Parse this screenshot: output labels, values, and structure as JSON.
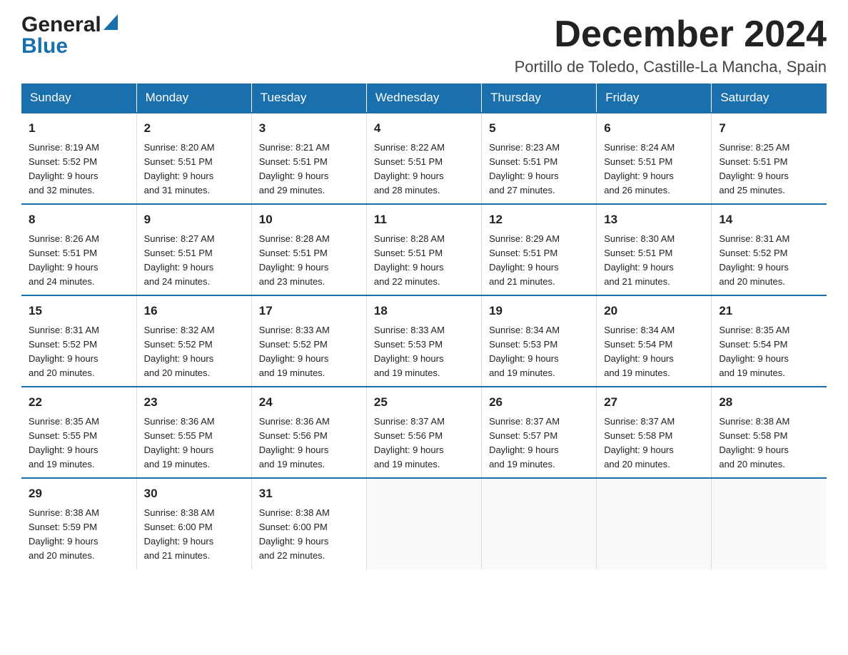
{
  "logo": {
    "general": "General",
    "blue": "Blue",
    "triangle_color": "#1a6fad"
  },
  "header": {
    "month_title": "December 2024",
    "location": "Portillo de Toledo, Castille-La Mancha, Spain"
  },
  "weekdays": [
    "Sunday",
    "Monday",
    "Tuesday",
    "Wednesday",
    "Thursday",
    "Friday",
    "Saturday"
  ],
  "weeks": [
    [
      {
        "day": "1",
        "sunrise": "8:19 AM",
        "sunset": "5:52 PM",
        "daylight": "9 hours and 32 minutes."
      },
      {
        "day": "2",
        "sunrise": "8:20 AM",
        "sunset": "5:51 PM",
        "daylight": "9 hours and 31 minutes."
      },
      {
        "day": "3",
        "sunrise": "8:21 AM",
        "sunset": "5:51 PM",
        "daylight": "9 hours and 29 minutes."
      },
      {
        "day": "4",
        "sunrise": "8:22 AM",
        "sunset": "5:51 PM",
        "daylight": "9 hours and 28 minutes."
      },
      {
        "day": "5",
        "sunrise": "8:23 AM",
        "sunset": "5:51 PM",
        "daylight": "9 hours and 27 minutes."
      },
      {
        "day": "6",
        "sunrise": "8:24 AM",
        "sunset": "5:51 PM",
        "daylight": "9 hours and 26 minutes."
      },
      {
        "day": "7",
        "sunrise": "8:25 AM",
        "sunset": "5:51 PM",
        "daylight": "9 hours and 25 minutes."
      }
    ],
    [
      {
        "day": "8",
        "sunrise": "8:26 AM",
        "sunset": "5:51 PM",
        "daylight": "9 hours and 24 minutes."
      },
      {
        "day": "9",
        "sunrise": "8:27 AM",
        "sunset": "5:51 PM",
        "daylight": "9 hours and 24 minutes."
      },
      {
        "day": "10",
        "sunrise": "8:28 AM",
        "sunset": "5:51 PM",
        "daylight": "9 hours and 23 minutes."
      },
      {
        "day": "11",
        "sunrise": "8:28 AM",
        "sunset": "5:51 PM",
        "daylight": "9 hours and 22 minutes."
      },
      {
        "day": "12",
        "sunrise": "8:29 AM",
        "sunset": "5:51 PM",
        "daylight": "9 hours and 21 minutes."
      },
      {
        "day": "13",
        "sunrise": "8:30 AM",
        "sunset": "5:51 PM",
        "daylight": "9 hours and 21 minutes."
      },
      {
        "day": "14",
        "sunrise": "8:31 AM",
        "sunset": "5:52 PM",
        "daylight": "9 hours and 20 minutes."
      }
    ],
    [
      {
        "day": "15",
        "sunrise": "8:31 AM",
        "sunset": "5:52 PM",
        "daylight": "9 hours and 20 minutes."
      },
      {
        "day": "16",
        "sunrise": "8:32 AM",
        "sunset": "5:52 PM",
        "daylight": "9 hours and 20 minutes."
      },
      {
        "day": "17",
        "sunrise": "8:33 AM",
        "sunset": "5:52 PM",
        "daylight": "9 hours and 19 minutes."
      },
      {
        "day": "18",
        "sunrise": "8:33 AM",
        "sunset": "5:53 PM",
        "daylight": "9 hours and 19 minutes."
      },
      {
        "day": "19",
        "sunrise": "8:34 AM",
        "sunset": "5:53 PM",
        "daylight": "9 hours and 19 minutes."
      },
      {
        "day": "20",
        "sunrise": "8:34 AM",
        "sunset": "5:54 PM",
        "daylight": "9 hours and 19 minutes."
      },
      {
        "day": "21",
        "sunrise": "8:35 AM",
        "sunset": "5:54 PM",
        "daylight": "9 hours and 19 minutes."
      }
    ],
    [
      {
        "day": "22",
        "sunrise": "8:35 AM",
        "sunset": "5:55 PM",
        "daylight": "9 hours and 19 minutes."
      },
      {
        "day": "23",
        "sunrise": "8:36 AM",
        "sunset": "5:55 PM",
        "daylight": "9 hours and 19 minutes."
      },
      {
        "day": "24",
        "sunrise": "8:36 AM",
        "sunset": "5:56 PM",
        "daylight": "9 hours and 19 minutes."
      },
      {
        "day": "25",
        "sunrise": "8:37 AM",
        "sunset": "5:56 PM",
        "daylight": "9 hours and 19 minutes."
      },
      {
        "day": "26",
        "sunrise": "8:37 AM",
        "sunset": "5:57 PM",
        "daylight": "9 hours and 19 minutes."
      },
      {
        "day": "27",
        "sunrise": "8:37 AM",
        "sunset": "5:58 PM",
        "daylight": "9 hours and 20 minutes."
      },
      {
        "day": "28",
        "sunrise": "8:38 AM",
        "sunset": "5:58 PM",
        "daylight": "9 hours and 20 minutes."
      }
    ],
    [
      {
        "day": "29",
        "sunrise": "8:38 AM",
        "sunset": "5:59 PM",
        "daylight": "9 hours and 20 minutes."
      },
      {
        "day": "30",
        "sunrise": "8:38 AM",
        "sunset": "6:00 PM",
        "daylight": "9 hours and 21 minutes."
      },
      {
        "day": "31",
        "sunrise": "8:38 AM",
        "sunset": "6:00 PM",
        "daylight": "9 hours and 22 minutes."
      },
      null,
      null,
      null,
      null
    ]
  ],
  "labels": {
    "sunrise": "Sunrise:",
    "sunset": "Sunset:",
    "daylight": "Daylight:"
  }
}
